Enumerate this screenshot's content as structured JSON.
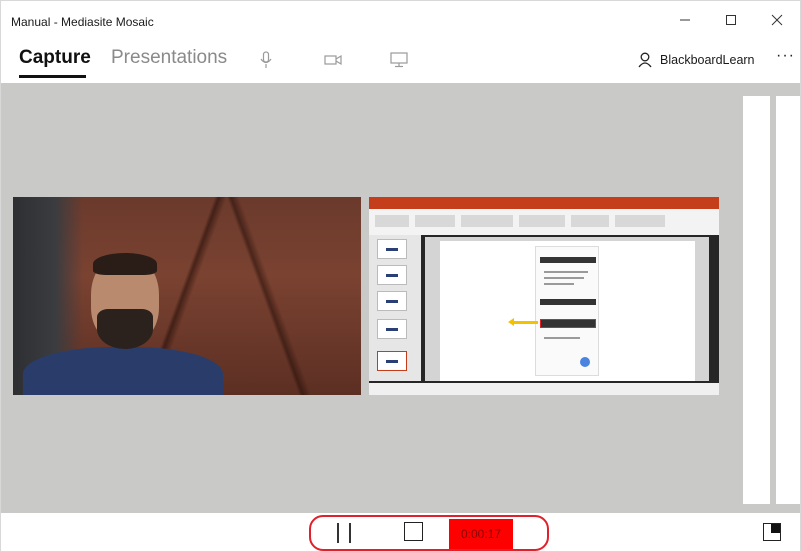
{
  "window": {
    "title": "Manual - Mediasite Mosaic",
    "controls": [
      "minimize",
      "maximize",
      "close"
    ]
  },
  "nav": {
    "tabs": [
      {
        "label": "Capture",
        "active": true
      },
      {
        "label": "Presentations",
        "active": false
      }
    ],
    "source_icons": [
      "microphone-icon",
      "camera-icon",
      "monitor-icon"
    ],
    "user": {
      "name": "BlackboardLearn",
      "icon": "person-icon"
    },
    "more_label": "···"
  },
  "stage": {
    "feeds": [
      {
        "kind": "camera",
        "icon": "webcam-feed"
      },
      {
        "kind": "screen",
        "icon": "screen-capture-feed"
      }
    ]
  },
  "recording": {
    "timer": "0:00:17",
    "timer_color": "#ff0000",
    "ring_color": "#e0202a",
    "buttons": [
      "pause",
      "stop"
    ]
  },
  "layout_button": {
    "icon": "layout-toggle-icon"
  }
}
